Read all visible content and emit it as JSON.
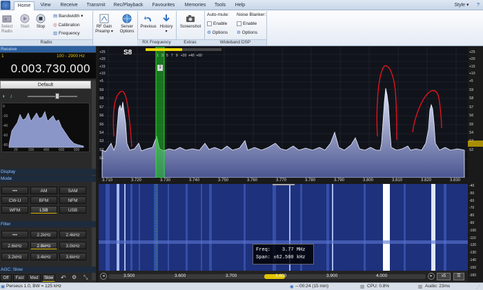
{
  "tabs": [
    "Home",
    "View",
    "Receive",
    "Transmit",
    "Rec/Playback",
    "Favourites",
    "Memories",
    "Tools",
    "Help"
  ],
  "style_label": "Style",
  "ribbon": {
    "select_radio": "Select Radio",
    "start": "Start",
    "stop": "Stop",
    "bandwidth": "Bandwidth",
    "calibration": "Calibration",
    "frequency": "Frequency",
    "rf_gain": "RF Gain Preamp",
    "server_options": "Server Options",
    "previous": "Previous",
    "history": "History",
    "screenshot": "Screenshot",
    "auto_mute": "Auto-mute:",
    "noise_blanker": "Noise Blanker:",
    "enable": "Enable",
    "options": "Options",
    "groups": {
      "radio": "Radio",
      "rx_frequency": "RX Frequency",
      "extras": "Extras",
      "wideband_dsp": "Wideband DSP"
    }
  },
  "left": {
    "receive_header": "Receive",
    "rx_num": "1",
    "bw_range": "100 - 2900 Hz",
    "frequency_display": "0.003.730.000",
    "preset": "Default",
    "spectrum_ticks": [
      "20",
      "200",
      "400",
      "600",
      "800"
    ],
    "spectrum_db": [
      "0",
      "-20",
      "-40",
      "-60",
      "-80"
    ],
    "display_header": "Display",
    "mode_header": "Mode",
    "modes": [
      "•••",
      "AM",
      "SAM",
      "CW-U",
      "BFM",
      "NFM",
      "WFM",
      "LSB",
      "USB"
    ],
    "selected_mode": "LSB",
    "filter_header": "Filter",
    "filters": [
      "•••",
      "2.2kHz",
      "2.4kHz",
      "2.6kHz",
      "2.8kHz",
      "3.0kHz",
      "3.2kHz",
      "3.4kHz",
      "3.6kHz"
    ],
    "selected_filter": "2.8kHz",
    "agc_header": "AGC: Slow",
    "agc_buttons": [
      "Off",
      "Fast",
      "Med",
      "Slow"
    ],
    "selected_agc": "Slow"
  },
  "spectrum": {
    "smeter": "S8",
    "smeter_scale": [
      "1",
      "3",
      "5",
      "7",
      "9",
      "+20",
      "+40",
      "+60"
    ],
    "db_left": [
      "+25",
      "+20",
      "+15",
      "+10",
      "+5",
      "S9",
      "S8",
      "S7",
      "S6",
      "S5",
      "S4",
      "S3",
      "S2",
      "S1"
    ],
    "db_right": [
      "+25",
      "+20",
      "+15",
      "+10",
      "+5",
      "S9",
      "S8",
      "S7",
      "S6",
      "S5",
      "S4",
      "S3",
      "S2"
    ],
    "freq_ticks": [
      "3.710",
      "3.720",
      "3.730",
      "3.740",
      "3.750",
      "3.760",
      "3.770",
      "3.780",
      "3.790",
      "3.800",
      "3.810",
      "3.820",
      "3.830"
    ],
    "marker": "1"
  },
  "waterfall": {
    "tooltip_freq_label": "Freq:",
    "tooltip_freq": "3.77 MHz",
    "tooltip_span_label": "Span:",
    "tooltip_span": "±62.500 kHz",
    "axis_ticks": [
      "3.500",
      "3.600",
      "3.700",
      "3.800",
      "3.900",
      "4.000"
    ],
    "zoom": "x5",
    "right_scale": [
      "-40",
      "-50",
      "-60",
      "-70",
      "-80",
      "-90",
      "-100",
      "-110",
      "-120",
      "-130",
      "-140",
      "-150",
      "-160"
    ]
  },
  "status": {
    "device": "Perseus 1.0, BW = 125 kHz",
    "recording": "--:00:24 (15 min)",
    "cpu": "CPU: 0.8%",
    "audio": "Audio: 23ms"
  },
  "colors": {
    "accent": "#d8b400",
    "spectrum_fill": "#8a96c8",
    "marker": "#22c422",
    "annotation": "#e0141c"
  }
}
